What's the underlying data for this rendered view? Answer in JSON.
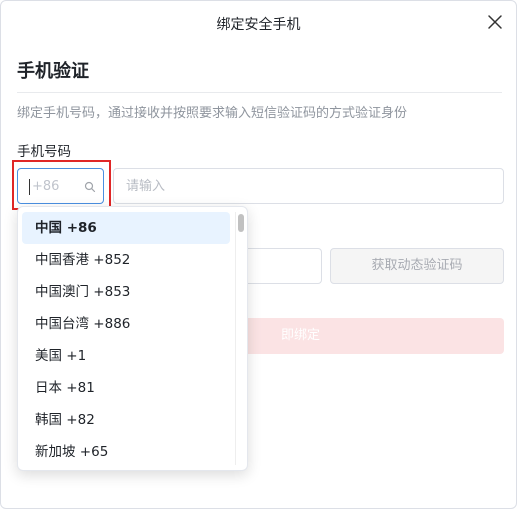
{
  "dialog": {
    "title": "绑定安全手机",
    "heading": "手机验证",
    "description": "绑定手机号码，通过接收并按照要求输入短信验证码的方式验证身份"
  },
  "phone": {
    "label": "手机号码",
    "country_code_value": "+86",
    "number_placeholder": "请输入"
  },
  "get_code_label": "获取动态验证码",
  "bind_label_visible": "即绑定",
  "country_codes": [
    {
      "label": "中国 +86",
      "selected": true
    },
    {
      "label": "中国香港 +852",
      "selected": false
    },
    {
      "label": "中国澳门 +853",
      "selected": false
    },
    {
      "label": "中国台湾 +886",
      "selected": false
    },
    {
      "label": "美国 +1",
      "selected": false
    },
    {
      "label": "日本 +81",
      "selected": false
    },
    {
      "label": "韩国 +82",
      "selected": false
    },
    {
      "label": "新加坡 +65",
      "selected": false
    }
  ],
  "colors": {
    "focus_border": "#4a90e2",
    "highlight_red": "#e02727",
    "selected_option_bg": "#e8f3ff",
    "disabled_primary_bg": "#fbe3e4"
  }
}
